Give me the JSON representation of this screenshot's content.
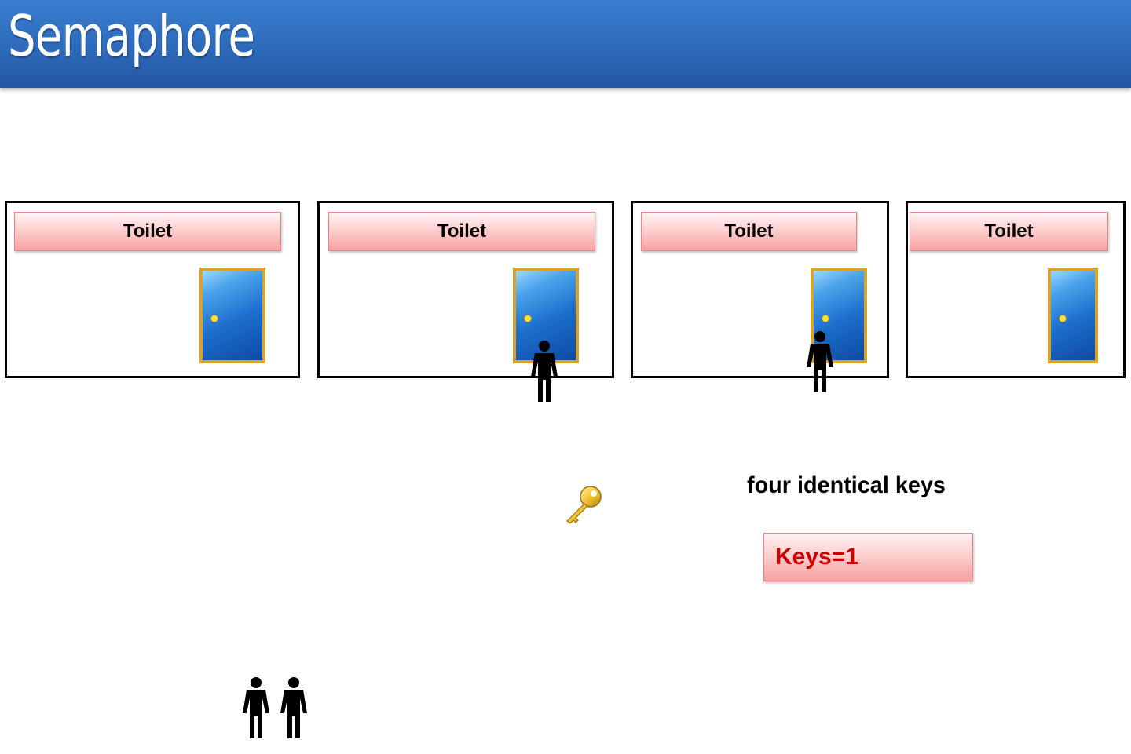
{
  "title": "Semaphore",
  "colors": {
    "header": "#2e6abb",
    "sign_fill": "#fdd0d0",
    "door": "#1d6fce",
    "door_frame": "#d9a22b",
    "keys_text": "#cc0000"
  },
  "stalls": [
    {
      "label": "Toilet"
    },
    {
      "label": "Toilet"
    },
    {
      "label": "Toilet"
    },
    {
      "label": "Toilet"
    }
  ],
  "caption": "four identical keys",
  "keys_counter": "Keys=1",
  "icons": [
    "door-icon",
    "person-icon",
    "key-icon"
  ]
}
